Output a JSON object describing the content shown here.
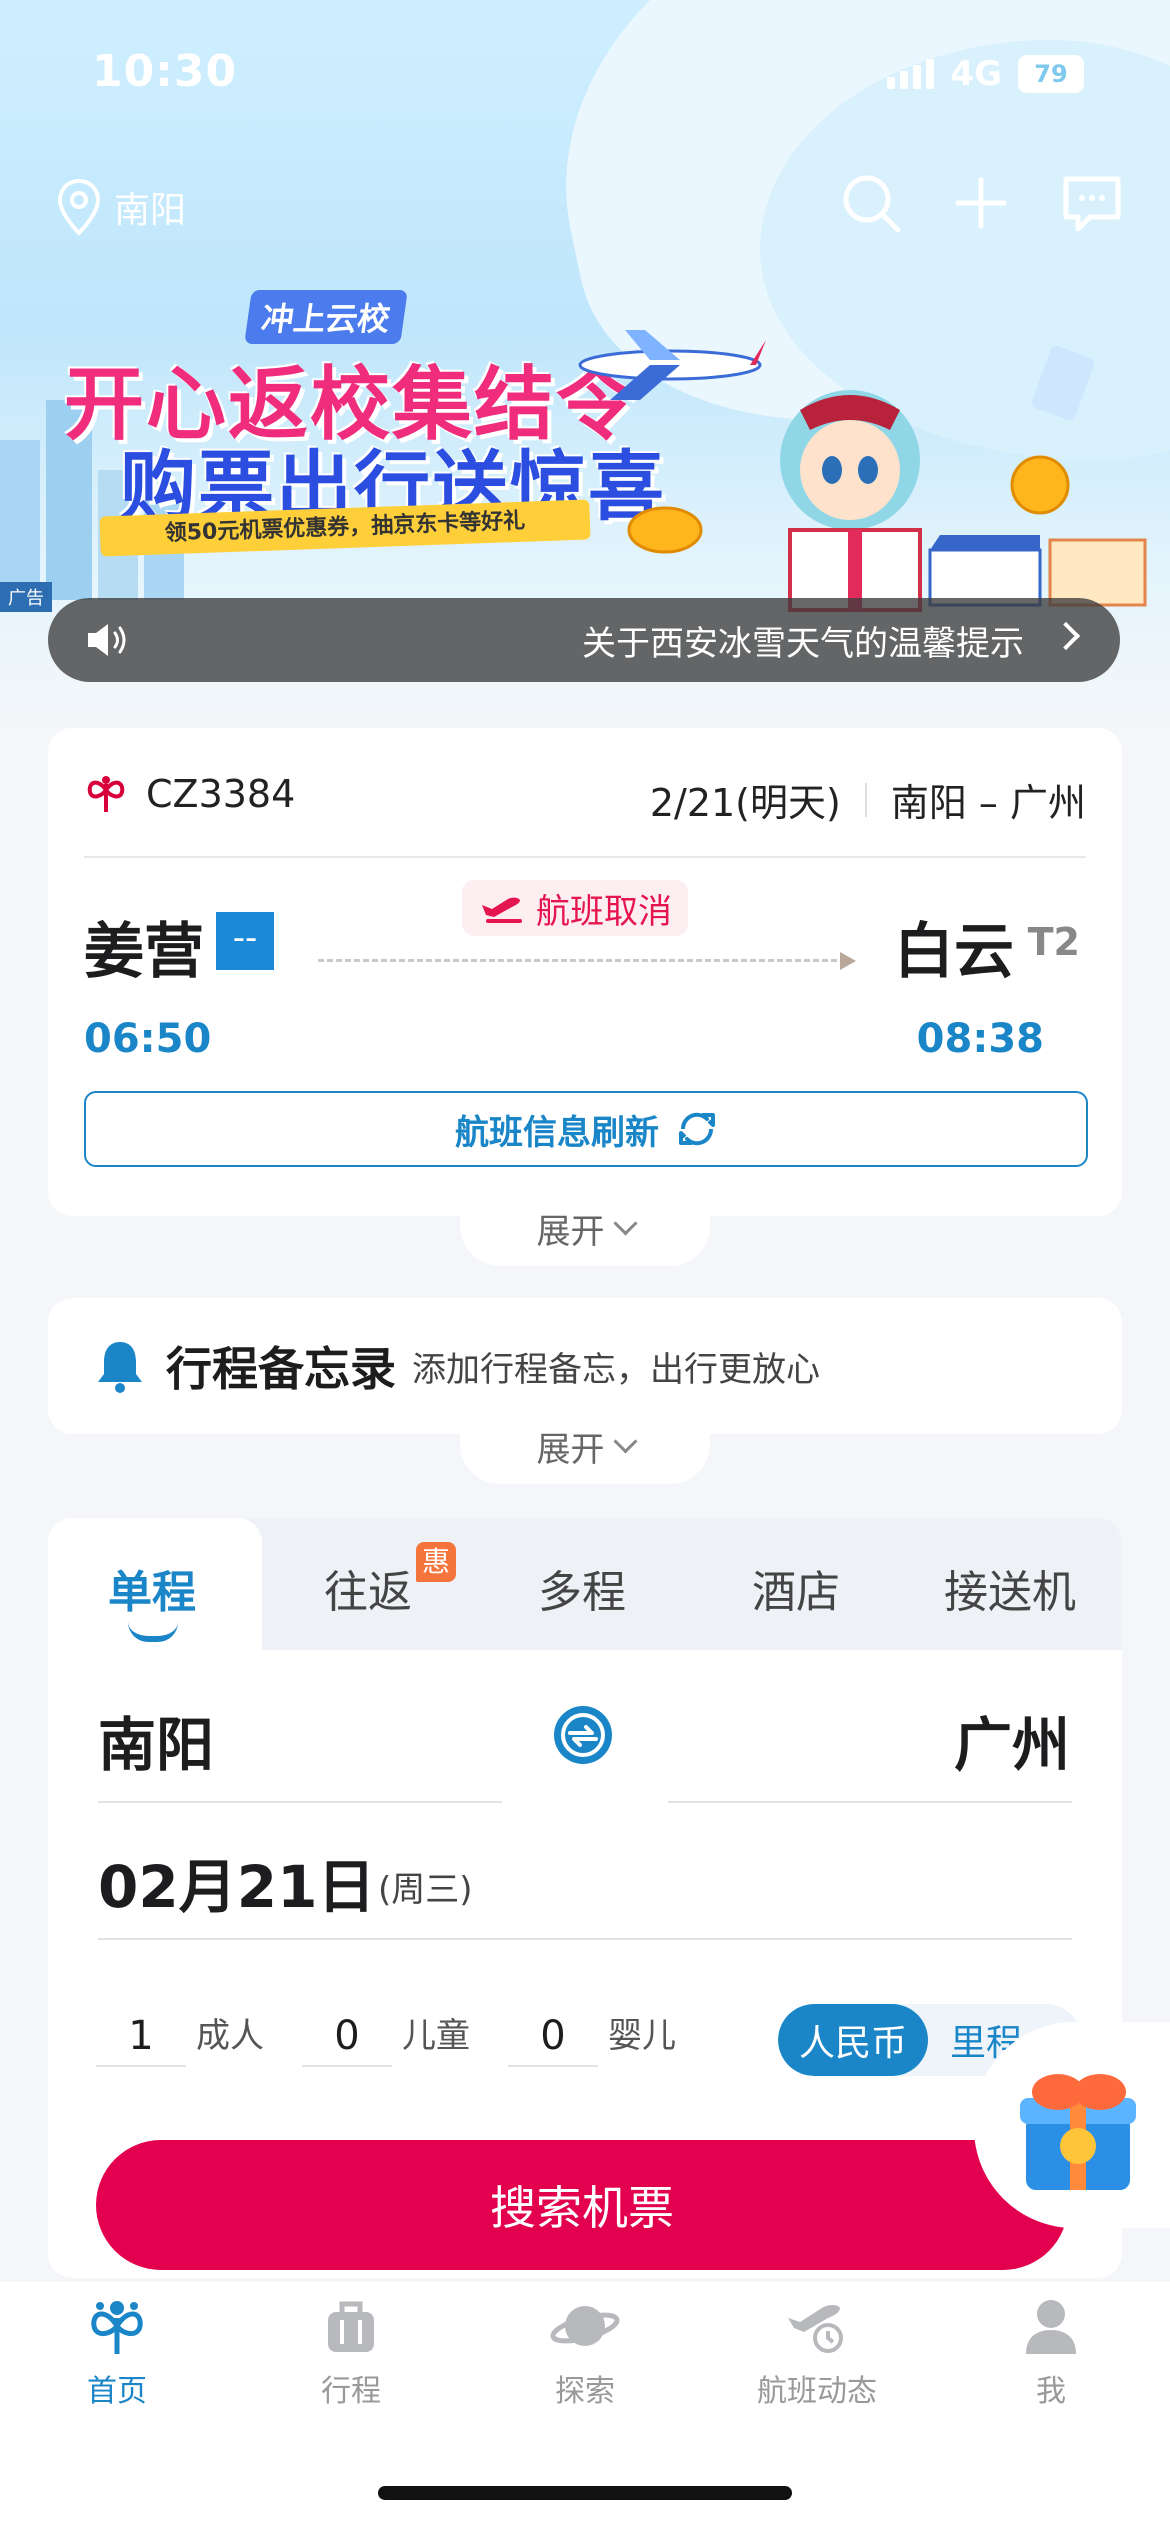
{
  "status_bar": {
    "time": "10:30",
    "network": "4G",
    "battery": "79"
  },
  "header": {
    "location": "南阳"
  },
  "banner": {
    "tag": "冲上云校",
    "line1": "开心返校集结令",
    "line2": "购票出行送惊喜",
    "ribbon": "领50元机票优惠券，抽京东卡等好礼",
    "ad_label": "广告"
  },
  "notice": {
    "text": "关于西安冰雪天气的温馨提示"
  },
  "flight": {
    "number": "CZ3384",
    "date": "2/21(明天)",
    "route": "南阳 – 广州",
    "dep_airport": "姜营",
    "dep_terminal": "--",
    "arr_airport": "白云",
    "arr_terminal": "T2",
    "status": "航班取消",
    "dep_time": "06:50",
    "arr_time": "08:38",
    "refresh_label": "航班信息刷新",
    "expand_label": "展开"
  },
  "memo": {
    "title": "行程备忘录",
    "subtitle": "添加行程备忘，出行更放心",
    "expand_label": "展开"
  },
  "search": {
    "tabs": [
      "单程",
      "往返",
      "多程",
      "酒店",
      "接送机"
    ],
    "active_tab": "单程",
    "badge": "惠",
    "from_city": "南阳",
    "to_city": "广州",
    "date": "02月21日",
    "weekday": "(周三)",
    "passengers": [
      {
        "count": "1",
        "label": "成人"
      },
      {
        "count": "0",
        "label": "儿童"
      },
      {
        "count": "0",
        "label": "婴儿"
      }
    ],
    "currency_active": "人民币",
    "currency_other": "里程",
    "button": "搜索机票"
  },
  "nav": {
    "items": [
      {
        "label": "首页",
        "icon": "home-logo-icon"
      },
      {
        "label": "行程",
        "icon": "luggage-icon"
      },
      {
        "label": "探索",
        "icon": "planet-icon"
      },
      {
        "label": "航班动态",
        "icon": "plane-status-icon"
      },
      {
        "label": "我",
        "icon": "person-icon"
      }
    ]
  },
  "colors": {
    "accent": "#1a86c8",
    "brand_red": "#e3004f",
    "cancel_red": "#e5154f"
  }
}
